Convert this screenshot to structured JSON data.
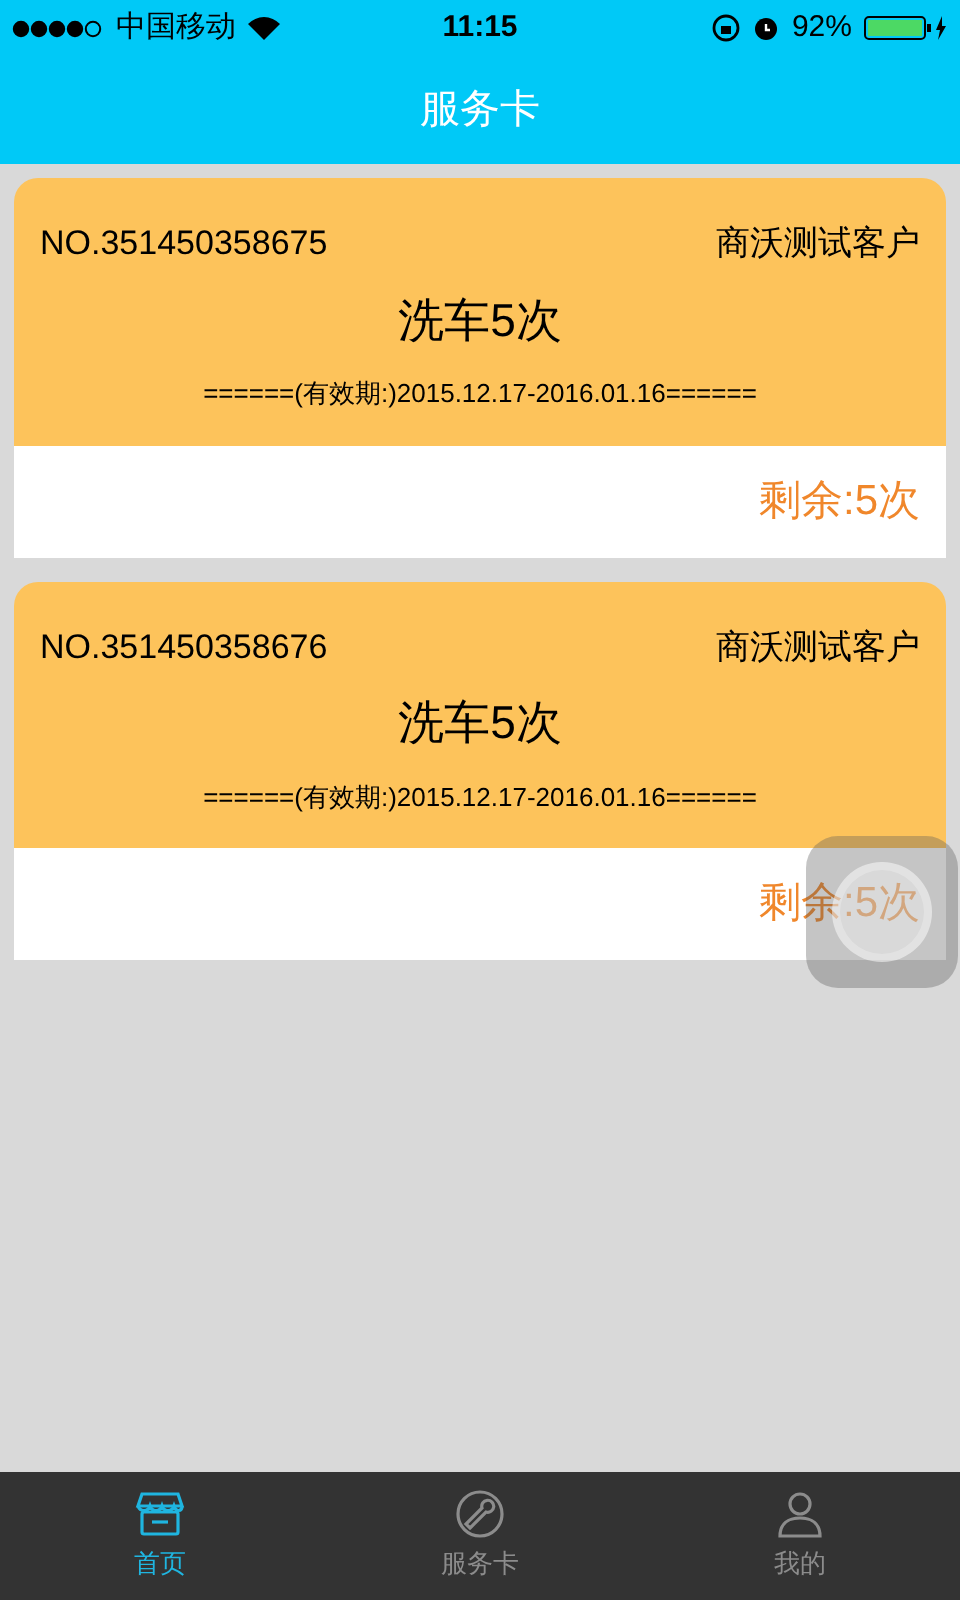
{
  "status_bar": {
    "carrier": "中国移动",
    "time": "11:15",
    "battery": "92%"
  },
  "header": {
    "title": "服务卡"
  },
  "cards": [
    {
      "number": "NO.351450358675",
      "customer": "商沃测试客户",
      "service": "洗车5次",
      "validity": "======(有效期:)2015.12.17-2016.01.16======",
      "remaining": "剩余:5次"
    },
    {
      "number": "NO.351450358676",
      "customer": "商沃测试客户",
      "service": "洗车5次",
      "validity": "======(有效期:)2015.12.17-2016.01.16======",
      "remaining": "剩余:5次"
    }
  ],
  "tab_bar": [
    {
      "kind": "home",
      "label": "首页",
      "selected": true
    },
    {
      "kind": "service",
      "label": "服务卡",
      "selected": false
    },
    {
      "kind": "profile",
      "label": "我的",
      "selected": false
    }
  ]
}
